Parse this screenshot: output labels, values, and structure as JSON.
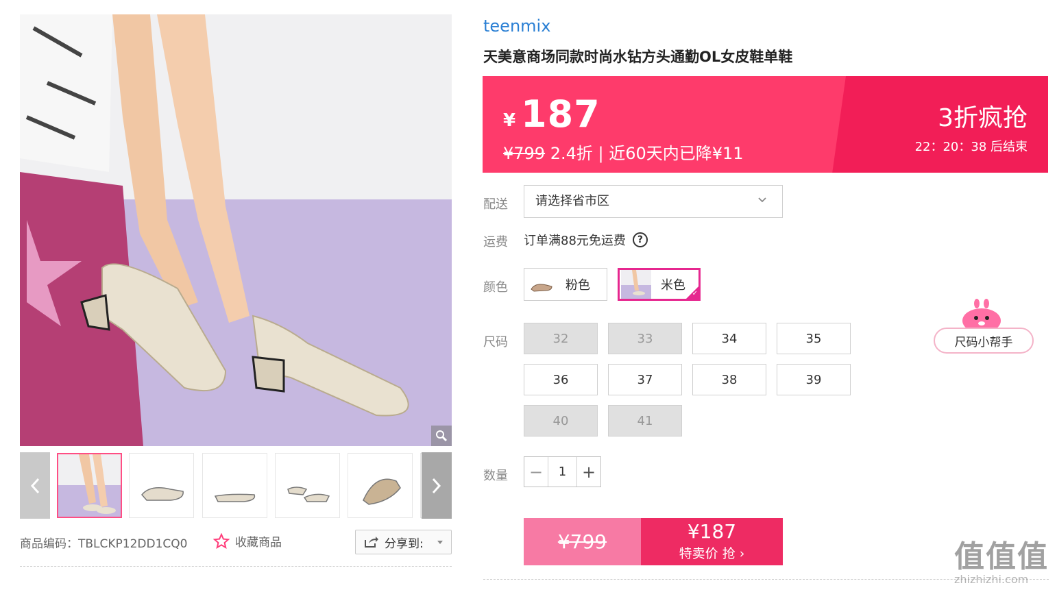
{
  "gallery": {
    "thumbnails": [
      {
        "name": "thumb-1",
        "active": true
      },
      {
        "name": "thumb-2"
      },
      {
        "name": "thumb-3"
      },
      {
        "name": "thumb-4"
      },
      {
        "name": "thumb-5"
      },
      {
        "name": "thumb-6"
      }
    ],
    "product_code_label": "商品编码：TBLCKP12DD1CQ0",
    "favorite_label": "收藏商品",
    "share_label": "分享到:",
    "icons": {
      "zoom": "magnifier-icon",
      "favorite": "star-icon",
      "share": "share-icon"
    }
  },
  "product": {
    "brand": "teenmix",
    "title": "天美意商场同款时尚水钻方头通勤OL女皮鞋单鞋"
  },
  "price_banner": {
    "currency": "¥",
    "price": "187",
    "original_price": "¥799",
    "discount_text": " 2.4折 | 近60天内已降¥11",
    "promo_label": "3折疯抢",
    "countdown": "22：20：38  后结束",
    "colors": {
      "primary": "#fe3b6b",
      "stripe": "#f21e57"
    }
  },
  "delivery": {
    "label": "配送",
    "region_placeholder": "请选择省市区"
  },
  "freight": {
    "label": "运费",
    "text": "订单满88元免运费",
    "help_icon": "?"
  },
  "color": {
    "label": "颜色",
    "options": [
      {
        "label": "粉色",
        "selected": false
      },
      {
        "label": "米色",
        "selected": true
      }
    ],
    "accent": "#e6278f"
  },
  "size": {
    "label": "尺码",
    "options": [
      {
        "label": "32",
        "available": false
      },
      {
        "label": "33",
        "available": false
      },
      {
        "label": "34",
        "available": true
      },
      {
        "label": "35",
        "available": true
      },
      {
        "label": "36",
        "available": true
      },
      {
        "label": "37",
        "available": true
      },
      {
        "label": "38",
        "available": true
      },
      {
        "label": "39",
        "available": true
      },
      {
        "label": "40",
        "available": false
      },
      {
        "label": "41",
        "available": false
      }
    ],
    "helper_label": "尺码小帮手"
  },
  "quantity": {
    "label": "数量",
    "value": "1",
    "minus": "−",
    "plus": "+"
  },
  "buy": {
    "original_price": "¥799",
    "price": "¥187",
    "action": "特卖价 抢 ›"
  },
  "watermark": {
    "main": "值值值",
    "sub": "zhizhizhi.com"
  }
}
